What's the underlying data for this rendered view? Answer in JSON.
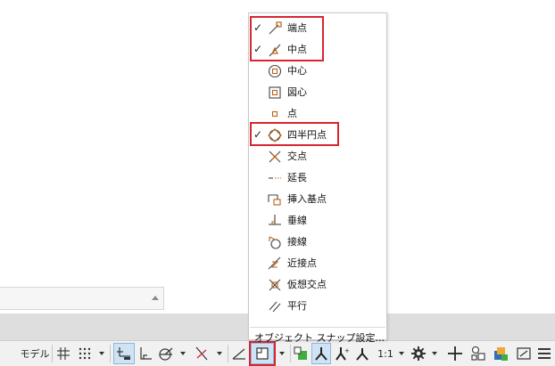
{
  "menu": {
    "items": [
      {
        "label": "端点",
        "checked": true,
        "icon": "endpoint-icon"
      },
      {
        "label": "中点",
        "checked": true,
        "icon": "midpoint-icon"
      },
      {
        "label": "中心",
        "checked": false,
        "icon": "center-icon"
      },
      {
        "label": "図心",
        "checked": false,
        "icon": "geometric-center-icon"
      },
      {
        "label": "点",
        "checked": false,
        "icon": "node-icon"
      },
      {
        "label": "四半円点",
        "checked": true,
        "icon": "quadrant-icon"
      },
      {
        "label": "交点",
        "checked": false,
        "icon": "intersection-icon"
      },
      {
        "label": "延長",
        "checked": false,
        "icon": "extension-icon"
      },
      {
        "label": "挿入基点",
        "checked": false,
        "icon": "insertion-icon"
      },
      {
        "label": "垂線",
        "checked": false,
        "icon": "perpendicular-icon"
      },
      {
        "label": "接線",
        "checked": false,
        "icon": "tangent-icon"
      },
      {
        "label": "近接点",
        "checked": false,
        "icon": "nearest-icon"
      },
      {
        "label": "仮想交点",
        "checked": false,
        "icon": "apparent-intersection-icon"
      },
      {
        "label": "平行",
        "checked": false,
        "icon": "parallel-icon"
      }
    ],
    "check_glyph": "✓",
    "footer_label": "オブジェクト スナップ設定..."
  },
  "statusbar": {
    "model_label": "モデル",
    "scale_label": "1:1"
  },
  "colors": {
    "highlight_red": "#d8262f",
    "snap_icon_brown": "#b5651d",
    "active_blue": "#cfe3f5"
  }
}
